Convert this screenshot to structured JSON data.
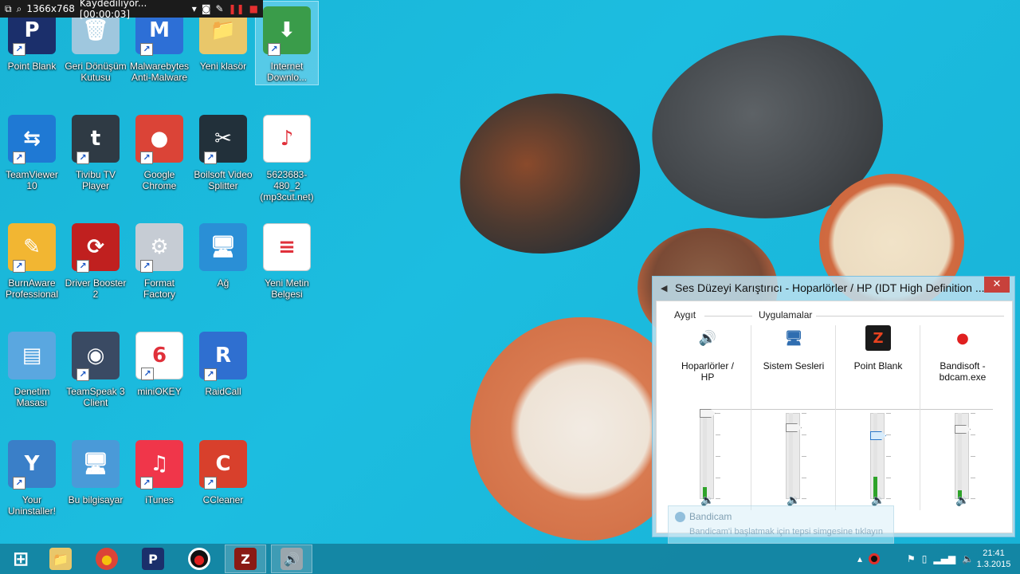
{
  "recorder": {
    "resolution": "1366x768",
    "status": "Kaydediliyor... [00:00:03]"
  },
  "desktop_icons": [
    {
      "label": "Point Blank",
      "icon": "point-blank-icon",
      "color": "#1b2f6b",
      "glyph": "P"
    },
    {
      "label": "Geri Dönüşüm\nKutusu",
      "icon": "recycle-bin-icon",
      "color": "#9fc7de",
      "glyph": "🗑"
    },
    {
      "label": "Malwarebytes\nAnti-Malware",
      "icon": "malwarebytes-icon",
      "color": "#2d6fd6",
      "glyph": "M"
    },
    {
      "label": "Yeni klasör",
      "icon": "folder-icon",
      "color": "#e9c76a",
      "glyph": "📁"
    },
    {
      "label": "Internet\nDownlo...",
      "icon": "idm-icon",
      "color": "#3a9c4a",
      "glyph": "⬇"
    },
    {
      "label": "TeamViewer 10",
      "icon": "teamviewer-icon",
      "color": "#1f79d4",
      "glyph": "⇆"
    },
    {
      "label": "Tivibu TV\nPlayer",
      "icon": "tivibu-icon",
      "color": "#2f3a44",
      "glyph": "t"
    },
    {
      "label": "Google\nChrome",
      "icon": "chrome-icon",
      "color": "#db4437",
      "glyph": "●"
    },
    {
      "label": "Boilsoft Video\nSplitter",
      "icon": "video-splitter-icon",
      "color": "#22303a",
      "glyph": "✂"
    },
    {
      "label": "5623683-480_2\n(mp3cut.net)",
      "icon": "m4r-file-icon",
      "color": "#ffffff",
      "glyph": "♪"
    },
    {
      "label": "BurnAware\nProfessional",
      "icon": "burnaware-icon",
      "color": "#f2b632",
      "glyph": "✎"
    },
    {
      "label": "Driver Booster\n2",
      "icon": "driver-booster-icon",
      "color": "#c0201f",
      "glyph": "⟳"
    },
    {
      "label": "Format Factory",
      "icon": "format-factory-icon",
      "color": "#c6ccd4",
      "glyph": "⚙"
    },
    {
      "label": "Ağ",
      "icon": "network-icon",
      "color": "#2a8fd6",
      "glyph": "🖥"
    },
    {
      "label": "Yeni Metin\nBelgesi",
      "icon": "text-document-icon",
      "color": "#ffffff",
      "glyph": "≡"
    },
    {
      "label": "Denetim\nMasası",
      "icon": "control-panel-icon",
      "color": "#5aa7e0",
      "glyph": "▤"
    },
    {
      "label": "TeamSpeak 3\nClient",
      "icon": "teamspeak-icon",
      "color": "#3a4a63",
      "glyph": "◉"
    },
    {
      "label": "miniOKEY",
      "icon": "miniokey-icon",
      "color": "#ffffff",
      "glyph": "6"
    },
    {
      "label": "RaidCall",
      "icon": "raidcall-icon",
      "color": "#2f6fd0",
      "glyph": "R"
    },
    {
      "label": "Your\nUninstaller!",
      "icon": "your-uninstaller-icon",
      "color": "#3a7fc8",
      "glyph": "Y"
    },
    {
      "label": "Bu bilgisayar",
      "icon": "this-pc-icon",
      "color": "#4a9ad8",
      "glyph": "🖥"
    },
    {
      "label": "iTunes",
      "icon": "itunes-icon",
      "color": "#f0364a",
      "glyph": "♫"
    },
    {
      "label": "CCleaner",
      "icon": "ccleaner-icon",
      "color": "#d8402c",
      "glyph": "C"
    }
  ],
  "mixer": {
    "title": "Ses Düzeyi Karıştırıcı - Hoparlörler / HP (IDT High Definition ...",
    "close_glyph": "✕",
    "device_group": "Aygıt",
    "apps_group": "Uygulamalar",
    "channels": [
      {
        "name": "Hoparlörler /\nHP",
        "icon": "speakers-icon",
        "glyph": "🔊",
        "color": "#ffffff",
        "volume": 1.0,
        "meter": 0.14,
        "active": false
      },
      {
        "name": "Sistem Sesleri",
        "icon": "system-sounds-icon",
        "glyph": "🖥",
        "color": "#ffffff",
        "volume": 0.82,
        "meter": 0.0,
        "active": false
      },
      {
        "name": "Point Blank",
        "icon": "point-blank-icon",
        "glyph": "Z",
        "color": "#1a1a1a",
        "volume": 0.72,
        "meter": 0.26,
        "active": true
      },
      {
        "name": "Bandisoft -\nbdcam.exe",
        "icon": "bandicam-icon",
        "glyph": "●",
        "color": "#ffffff",
        "volume": 0.8,
        "meter": 0.1,
        "active": false
      }
    ]
  },
  "notification": {
    "title": "Bandicam",
    "text": "Bandicam'i başlatmak için tepsi simgesine tıklayın"
  },
  "taskbar": {
    "apps": [
      {
        "name": "start-button",
        "glyph": "⊞",
        "color": "transparent",
        "active": false
      },
      {
        "name": "file-explorer",
        "glyph": "📁",
        "color": "#e9c76a",
        "active": false
      },
      {
        "name": "chrome",
        "glyph": "●",
        "color": "#db4437",
        "active": false
      },
      {
        "name": "point-blank",
        "glyph": "P",
        "color": "#1b2f6b",
        "active": false
      },
      {
        "name": "bandicam",
        "glyph": "●",
        "color": "#111111",
        "active": false
      },
      {
        "name": "point-blank-game",
        "glyph": "Z",
        "color": "#8a1a14",
        "active": true
      },
      {
        "name": "volume-mixer",
        "glyph": "🔊",
        "color": "#9aa6ad",
        "active": true
      }
    ],
    "time": "21:41",
    "date": "1.3.2015"
  }
}
